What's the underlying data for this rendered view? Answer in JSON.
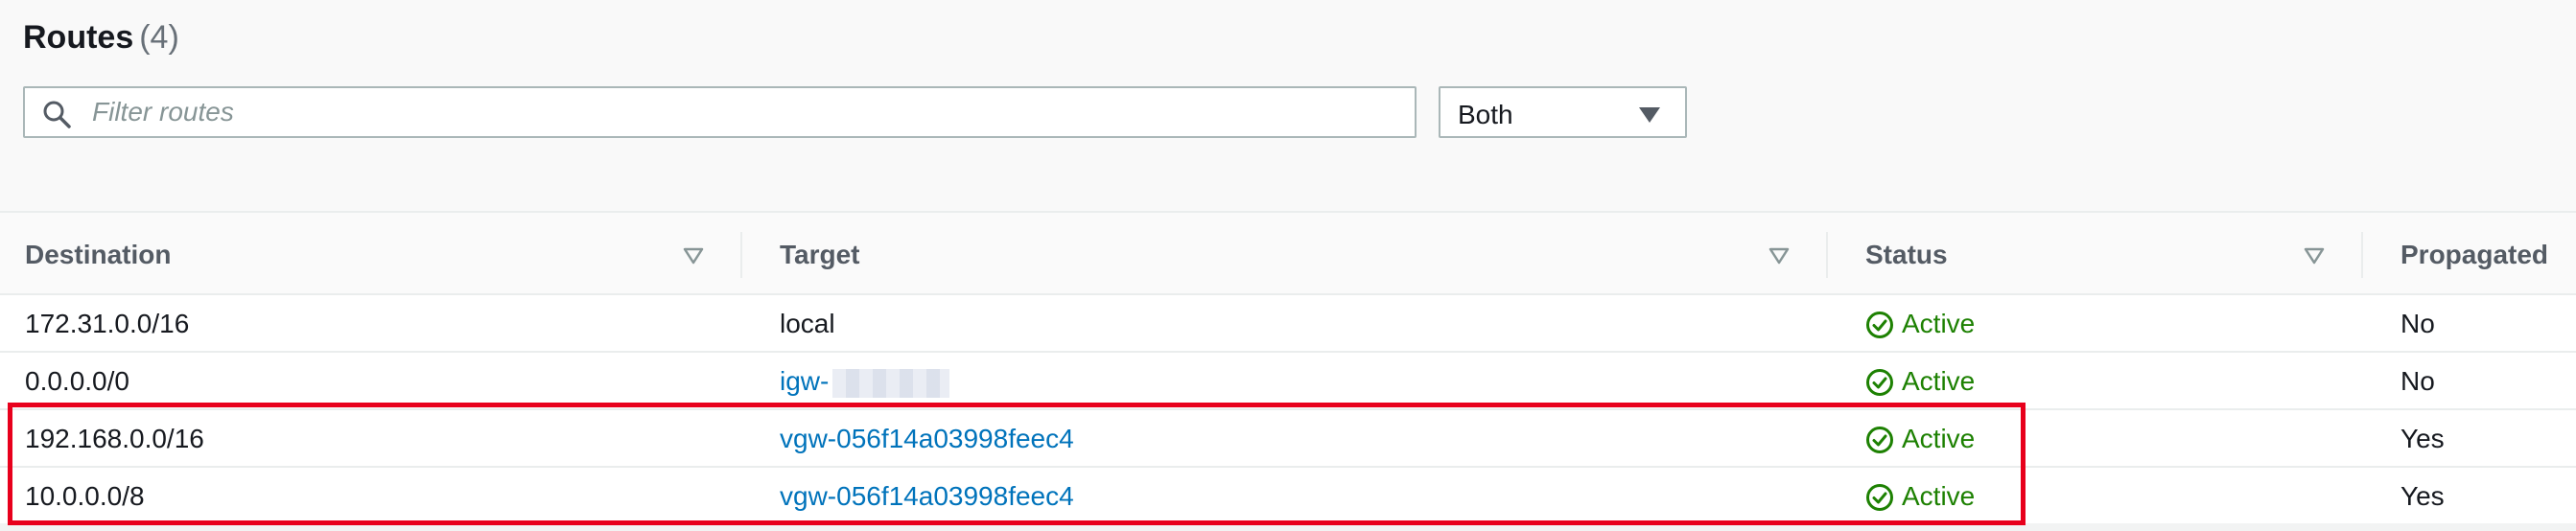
{
  "panel": {
    "title": "Routes",
    "count": "(4)"
  },
  "filter": {
    "placeholder": "Filter routes",
    "value": "",
    "dropdown_value": "Both"
  },
  "columns": {
    "destination": "Destination",
    "target": "Target",
    "status": "Status",
    "propagated": "Propagated"
  },
  "rows": [
    {
      "destination": "172.31.0.0/16",
      "target": "local",
      "target_is_link": false,
      "target_redacted": false,
      "status": "Active",
      "propagated": "No"
    },
    {
      "destination": "0.0.0.0/0",
      "target": "igw-",
      "target_is_link": true,
      "target_redacted": true,
      "status": "Active",
      "propagated": "No"
    },
    {
      "destination": "192.168.0.0/16",
      "target": "vgw-056f14a03998feec4",
      "target_is_link": true,
      "target_redacted": false,
      "status": "Active",
      "propagated": "Yes"
    },
    {
      "destination": "10.0.0.0/8",
      "target": "vgw-056f14a03998feec4",
      "target_is_link": true,
      "target_redacted": false,
      "status": "Active",
      "propagated": "Yes"
    }
  ],
  "icons": {
    "search": "search-icon",
    "caret": "caret-down-icon",
    "sort": "sort-down-icon",
    "status": "check-circle-icon"
  },
  "colors": {
    "link": "#0073bb",
    "status_active": "#1d8102",
    "highlight": "#e8001c"
  }
}
